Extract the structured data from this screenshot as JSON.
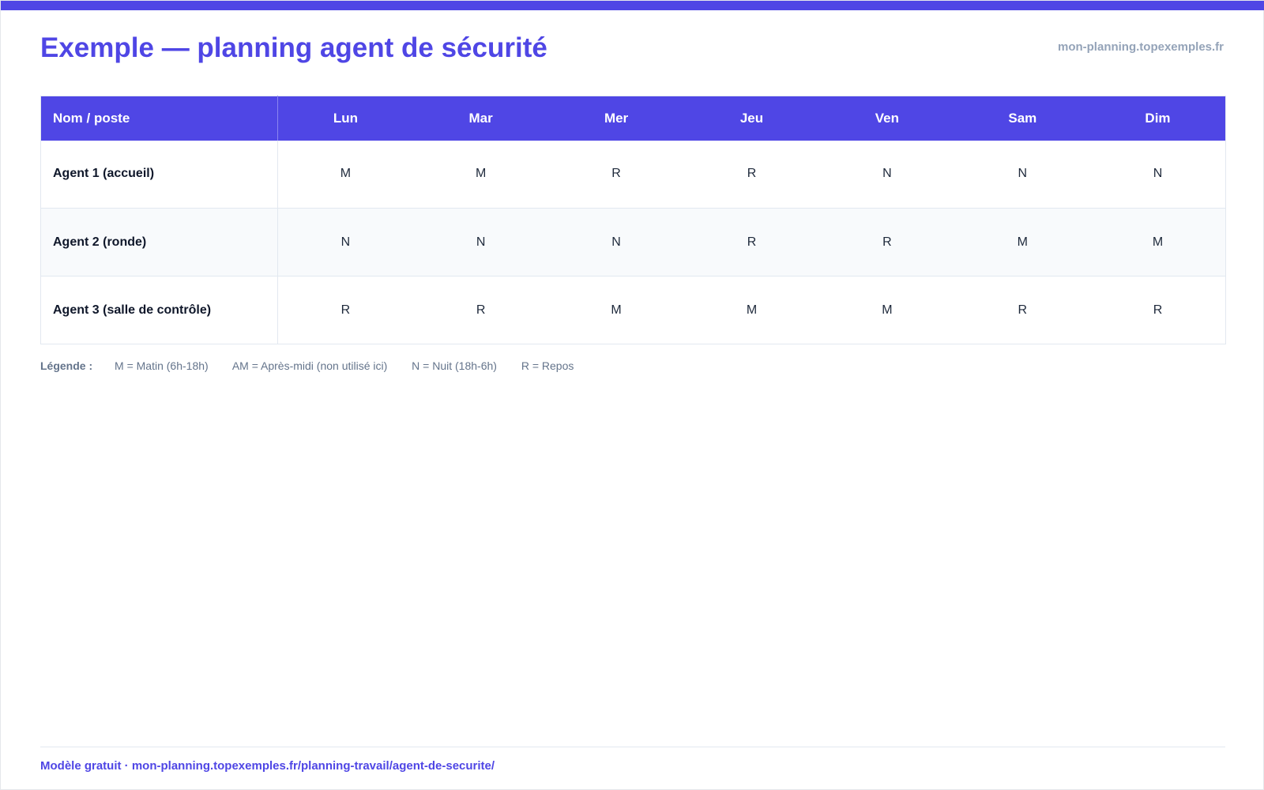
{
  "header": {
    "title": "Exemple — planning agent de sécurité",
    "site": "mon-planning.topexemples.fr"
  },
  "table": {
    "name_header": "Nom / poste",
    "days": [
      "Lun",
      "Mar",
      "Mer",
      "Jeu",
      "Ven",
      "Sam",
      "Dim"
    ],
    "rows": [
      {
        "name": "Agent 1 (accueil)",
        "shifts": [
          "M",
          "M",
          "R",
          "R",
          "N",
          "N",
          "N"
        ]
      },
      {
        "name": "Agent 2 (ronde)",
        "shifts": [
          "N",
          "N",
          "N",
          "R",
          "R",
          "M",
          "M"
        ]
      },
      {
        "name": "Agent 3 (salle de contrôle)",
        "shifts": [
          "R",
          "R",
          "M",
          "M",
          "M",
          "R",
          "R"
        ]
      }
    ]
  },
  "legend": {
    "title": "Légende :",
    "items": [
      "M = Matin (6h-18h)",
      "AM = Après-midi (non utilisé ici)",
      "N = Nuit (18h-6h)",
      "R = Repos"
    ]
  },
  "footer": {
    "text": "Modèle gratuit · mon-planning.topexemples.fr/planning-travail/agent-de-securite/"
  },
  "colors": {
    "accent": "#4f46e5",
    "muted": "#94a3b8",
    "row_alt": "#f8fafc"
  }
}
